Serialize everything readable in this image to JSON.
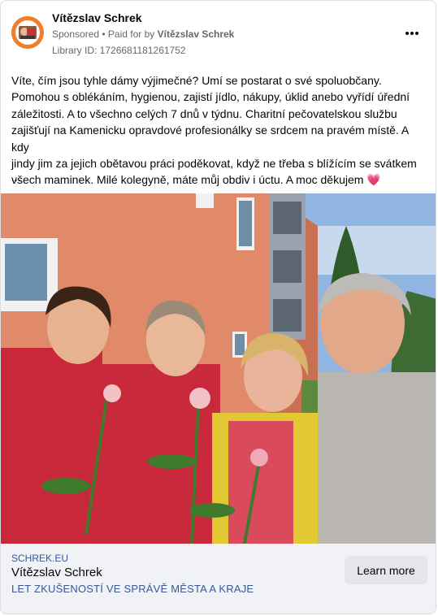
{
  "post": {
    "author": "Vítězslav Schrek",
    "sponsored": "Sponsored",
    "separator": " • ",
    "paid_for_prefix": "Paid for by ",
    "paid_for_name": "Vítězslav Schrek",
    "library_id": "Library ID: 1726681181261752",
    "text_lines": [
      "Víte, čím jsou tyhle dámy výjimečné? Umí se postarat o své spoluobčany.",
      "Pomohou s oblékáním, hygienou, zajistí jídlo, nákupy, úklid anebo vyřídí úřední",
      "záležitosti. A to všechno celých 7 dnů v týdnu. Charitní pečovatelskou službu",
      "zajišťují na Kamenicku opravdové profesionálky se srdcem na pravém místě. A kdy",
      "jindy jim za jejich obětavou práci poděkovat, když ne třeba s blížícím se svátkem",
      "všech maminek. Milé kolegyně, máte můj obdiv i úctu. A moc děkujem"
    ],
    "heart": "💗",
    "ellipsis": "..."
  },
  "link": {
    "domain": "SCHREK.EU",
    "title": "Vítězslav Schrek",
    "description": "LET ZKUŠENOSTÍ VE SPRÁVĚ MĚSTA A KRAJE",
    "cta": "Learn more"
  },
  "colors": {
    "link_blue": "#385898",
    "muted": "#65676b",
    "footer_bg": "#f0f2f5",
    "button_bg": "#e4e6eb"
  }
}
